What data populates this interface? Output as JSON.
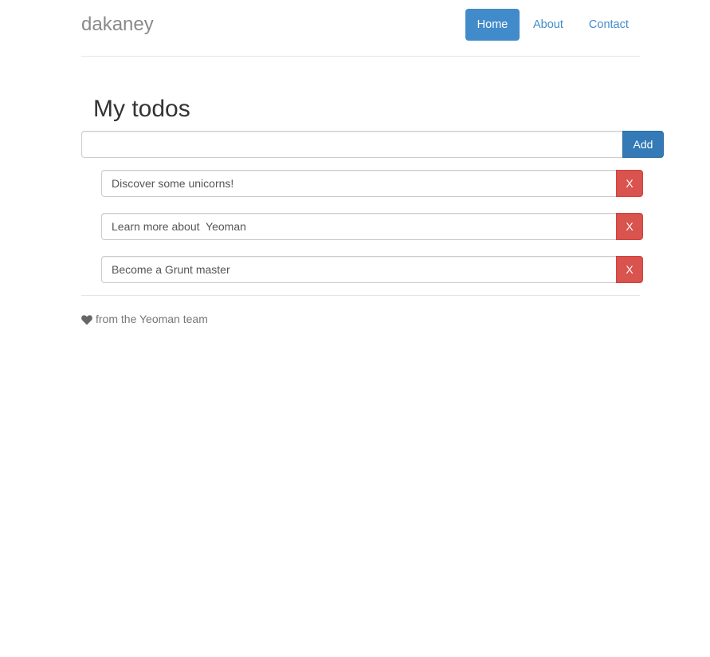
{
  "header": {
    "brand": "dakaney",
    "nav": [
      {
        "label": "Home",
        "active": true
      },
      {
        "label": "About",
        "active": false
      },
      {
        "label": "Contact",
        "active": false
      }
    ]
  },
  "main": {
    "title": "My todos",
    "new_todo": {
      "value": "",
      "placeholder": "",
      "add_label": "Add"
    },
    "todos": [
      {
        "text": "Discover some unicorns!",
        "delete_label": "X"
      },
      {
        "text": "Learn more about  Yeoman",
        "delete_label": "X"
      },
      {
        "text": "Become a Grunt master",
        "delete_label": "X"
      }
    ]
  },
  "footer": {
    "icon": "heart-icon",
    "text": "from the Yeoman team"
  },
  "colors": {
    "primary": "#428bca",
    "add_button": "#337ab7",
    "danger": "#d9534f",
    "brand_text": "#8a8a8a"
  }
}
